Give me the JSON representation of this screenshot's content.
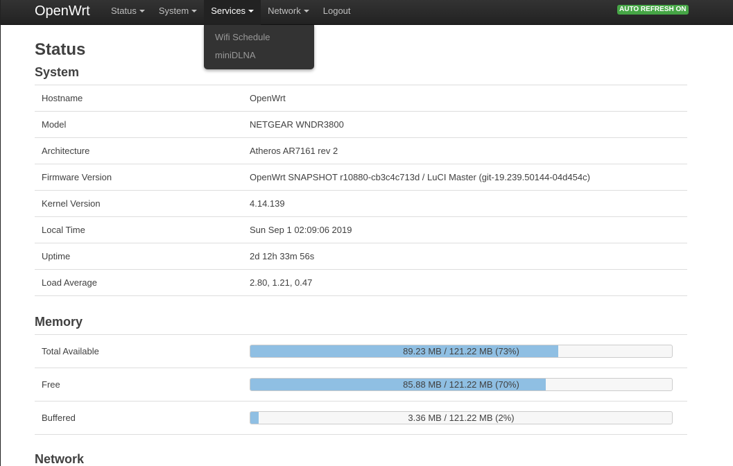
{
  "navbar": {
    "brand": "OpenWrt",
    "menu": [
      {
        "label": "Status",
        "dropdown": true
      },
      {
        "label": "System",
        "dropdown": true
      },
      {
        "label": "Services",
        "dropdown": true,
        "active": true
      },
      {
        "label": "Network",
        "dropdown": true
      },
      {
        "label": "Logout",
        "dropdown": false
      }
    ],
    "auto_refresh": "AUTO REFRESH ON"
  },
  "dropdown": {
    "items": [
      "Wifi Schedule",
      "miniDLNA"
    ]
  },
  "page_title": "Status",
  "system": {
    "title": "System",
    "rows": [
      {
        "label": "Hostname",
        "value": "OpenWrt"
      },
      {
        "label": "Model",
        "value": "NETGEAR WNDR3800"
      },
      {
        "label": "Architecture",
        "value": "Atheros AR7161 rev 2"
      },
      {
        "label": "Firmware Version",
        "value": "OpenWrt SNAPSHOT r10880-cb3c4c713d / LuCI Master (git-19.239.50144-04d454c)"
      },
      {
        "label": "Kernel Version",
        "value": "4.14.139"
      },
      {
        "label": "Local Time",
        "value": "Sun Sep 1 02:09:06 2019"
      },
      {
        "label": "Uptime",
        "value": "2d 12h 33m 56s"
      },
      {
        "label": "Load Average",
        "value": "2.80, 1.21, 0.47"
      }
    ]
  },
  "memory": {
    "title": "Memory",
    "rows": [
      {
        "label": "Total Available",
        "text": "89.23 MB / 121.22 MB (73%)",
        "percent": 73
      },
      {
        "label": "Free",
        "text": "85.88 MB / 121.22 MB (70%)",
        "percent": 70
      },
      {
        "label": "Buffered",
        "text": "3.36 MB / 121.22 MB (2%)",
        "percent": 2
      }
    ]
  },
  "network": {
    "title": "Network"
  },
  "colors": {
    "navbar": "#222222",
    "badge": "#46a546",
    "progress_fill": "#8fbfe3"
  }
}
